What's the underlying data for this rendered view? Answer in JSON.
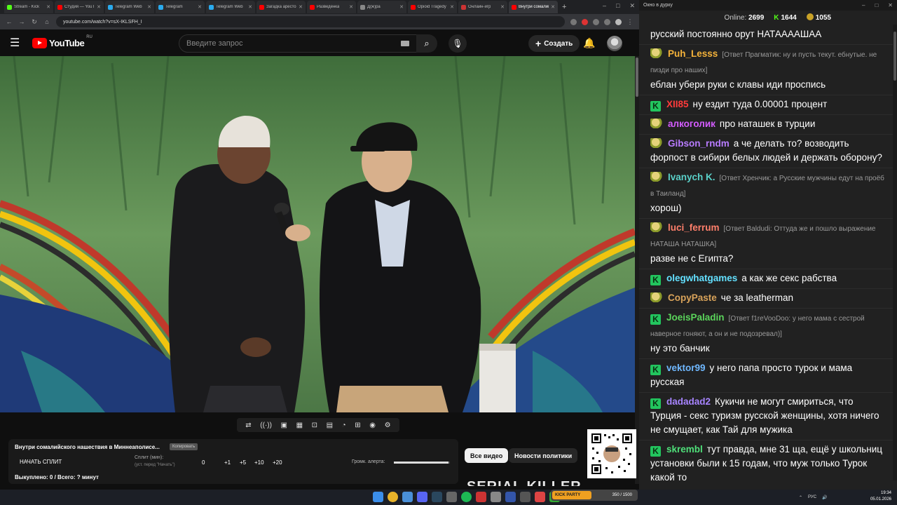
{
  "browser": {
    "tabs": [
      {
        "label": "Stream - Kick",
        "color": "#53fc18"
      },
      {
        "label": "Студия — YouTube",
        "color": "#ff0000"
      },
      {
        "label": "Telegram Web",
        "color": "#2aabee"
      },
      {
        "label": "Telegram",
        "color": "#2aabee"
      },
      {
        "label": "Telegram Web",
        "color": "#2aabee"
      },
      {
        "label": "Загадка арестованного",
        "color": "#ff0000"
      },
      {
        "label": "Разведенка",
        "color": "#ff0000"
      },
      {
        "label": "Д(ж)ра",
        "color": "#888888"
      },
      {
        "label": "Opioid Tragedy",
        "color": "#ff0000"
      },
      {
        "label": "Онлайн-игр",
        "color": "#cc3333"
      },
      {
        "label": "Внутри сомалийского",
        "color": "#ff0000",
        "active": true
      }
    ],
    "url": "youtube.com/watch?v=sX-IKLSFH_I"
  },
  "youtube": {
    "region": "RU",
    "search_placeholder": "Введите запрос",
    "create_label": "Создать"
  },
  "player_controls": [
    "⇄",
    "((·))",
    "▣",
    "▦",
    "⊡",
    "▤",
    "◔",
    "⊞",
    "◉",
    "⚙"
  ],
  "extension": {
    "video_title": "Внутри сомалийского нашествия в Миннеаполисе...",
    "badge": "Копировать",
    "start_split": "НАЧАТЬ СПЛИТ",
    "split_label": "Сплит (мин):",
    "split_sub": "(уст. перед \"Начать\")",
    "split_value": "0",
    "increments": [
      "+1",
      "+5",
      "+10",
      "+20"
    ],
    "volume_label": "Громк. алерта:",
    "volume_level": 0.98,
    "bought": "Выкуплено: 0 / Всего: ? минут"
  },
  "chips": {
    "all_videos": "Все видео",
    "politics": "Новости политики"
  },
  "watermark": "SERIAL     KILLER",
  "chat": {
    "window_title": "Окно в дурку",
    "online_label": "Online:",
    "online": "2699",
    "kick_count": "1644",
    "coin_count": "1055",
    "messages": [
      {
        "badge": "none",
        "user": "",
        "color": "#ffffff",
        "reply": "",
        "text": "русский постоянно орут НАТААААШАА"
      },
      {
        "badge": "coin",
        "user": "Puh_Lesss",
        "color": "#f5b33a",
        "reply": "[Ответ Прагматик: ну и пусть текут. ебнутые. не пизди про наших]",
        "text": "еблан убери руки с клавы иди проспись"
      },
      {
        "badge": "kick",
        "user": "XII85",
        "color": "#ff3b3b",
        "reply": "",
        "text": "ну ездит туда 0.00001 процент"
      },
      {
        "badge": "coin",
        "user": "алкоголик",
        "color": "#d45cff",
        "reply": "",
        "text": "про наташек в турции"
      },
      {
        "badge": "coin",
        "user": "Gibson_rndm",
        "color": "#b87cff",
        "reply": "",
        "text": "а че делать то? возводить форпост в сибири белых людей и держать оборону?"
      },
      {
        "badge": "coin",
        "user": "Ivanych K.",
        "color": "#5ad1c9",
        "reply": "[Ответ Хренчик: а Русские мужчины едут на проёб в Таиланд]",
        "text": "хорош)"
      },
      {
        "badge": "coin",
        "user": "luci_ferrum",
        "color": "#ff7f6b",
        "reply": "[Ответ Baldudi: Оттуда же и пошло выражение НАТАША НАТАШКА]",
        "text": "разве не с Египта?"
      },
      {
        "badge": "kick",
        "user": "olegwhatgames",
        "color": "#63e0ff",
        "reply": "",
        "text": "а как же секс рабства"
      },
      {
        "badge": "coin",
        "user": "CopyPaste",
        "color": "#d9a35a",
        "reply": "",
        "text": "че за leatherman"
      },
      {
        "badge": "kick",
        "user": "JoeisPaladin",
        "color": "#5bd45b",
        "reply": "[Ответ f1reVooDoo: у него мама с сестрой наверное гоняют, а он и не подозревал)]",
        "text": "ну это банчик"
      },
      {
        "badge": "kick",
        "user": "vektor99",
        "color": "#6fb8ff",
        "reply": "",
        "text": "у него папа просто турок и мама русская"
      },
      {
        "badge": "kick",
        "user": "dadadad2",
        "color": "#a784ff",
        "reply": "",
        "text": "Кукичи не могут смириться, что Турция - секс туризм русской женщины, хотя ничего не смущает, как Тай для мужика"
      },
      {
        "badge": "kick",
        "user": "skrembl",
        "color": "#4fe07a",
        "reply": "",
        "text": "тут правда, мне 31 ща, ещё у школьниц установки были к 15 годам, что муж только Турок какой то"
      }
    ]
  },
  "taskbar": {
    "pill_text": "350 / 1500",
    "pill_tag": "KICK PARTY",
    "lang": "РУС",
    "time": "19:34",
    "date": "05.01.2026"
  },
  "colors": {
    "kick_green": "#53fc18",
    "yt_red": "#ff0000"
  }
}
